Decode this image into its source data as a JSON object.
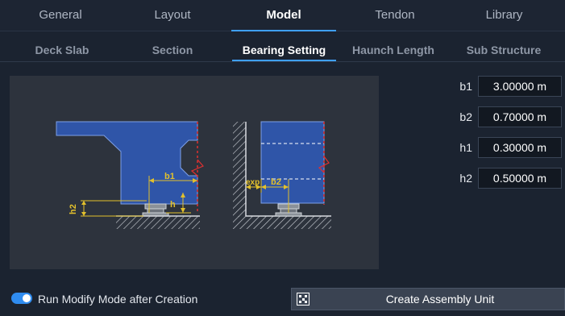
{
  "main_tabs": [
    {
      "label": "General",
      "active": false
    },
    {
      "label": "Layout",
      "active": false
    },
    {
      "label": "Model",
      "active": true
    },
    {
      "label": "Tendon",
      "active": false
    },
    {
      "label": "Library",
      "active": false
    }
  ],
  "sub_tabs": [
    {
      "label": "Deck Slab",
      "active": false
    },
    {
      "label": "Section",
      "active": false
    },
    {
      "label": "Bearing Setting",
      "active": true
    },
    {
      "label": "Haunch Length",
      "active": false
    },
    {
      "label": "Sub Structure",
      "active": false
    }
  ],
  "diagram": {
    "labels": {
      "b1_left": "b1",
      "h": "h",
      "h2": "h2",
      "exp": "exp",
      "b2": "b2"
    },
    "colors": {
      "section_fill": "#2f55a8",
      "dimension": "#e2c02c",
      "cut_line": "#e03030",
      "hatch": "#c8ccd2"
    }
  },
  "params": [
    {
      "label": "b1",
      "value": "3.00000 m"
    },
    {
      "label": "b2",
      "value": "0.70000 m"
    },
    {
      "label": "h1",
      "value": "0.30000 m"
    },
    {
      "label": "h2",
      "value": "0.50000 m"
    }
  ],
  "footer": {
    "toggle_label": "Run Modify Mode after Creation",
    "toggle_on": true,
    "create_button_label": "Create Assembly Unit",
    "create_button_icon": "assembly-icon"
  },
  "accent_color": "#3fa0ff"
}
